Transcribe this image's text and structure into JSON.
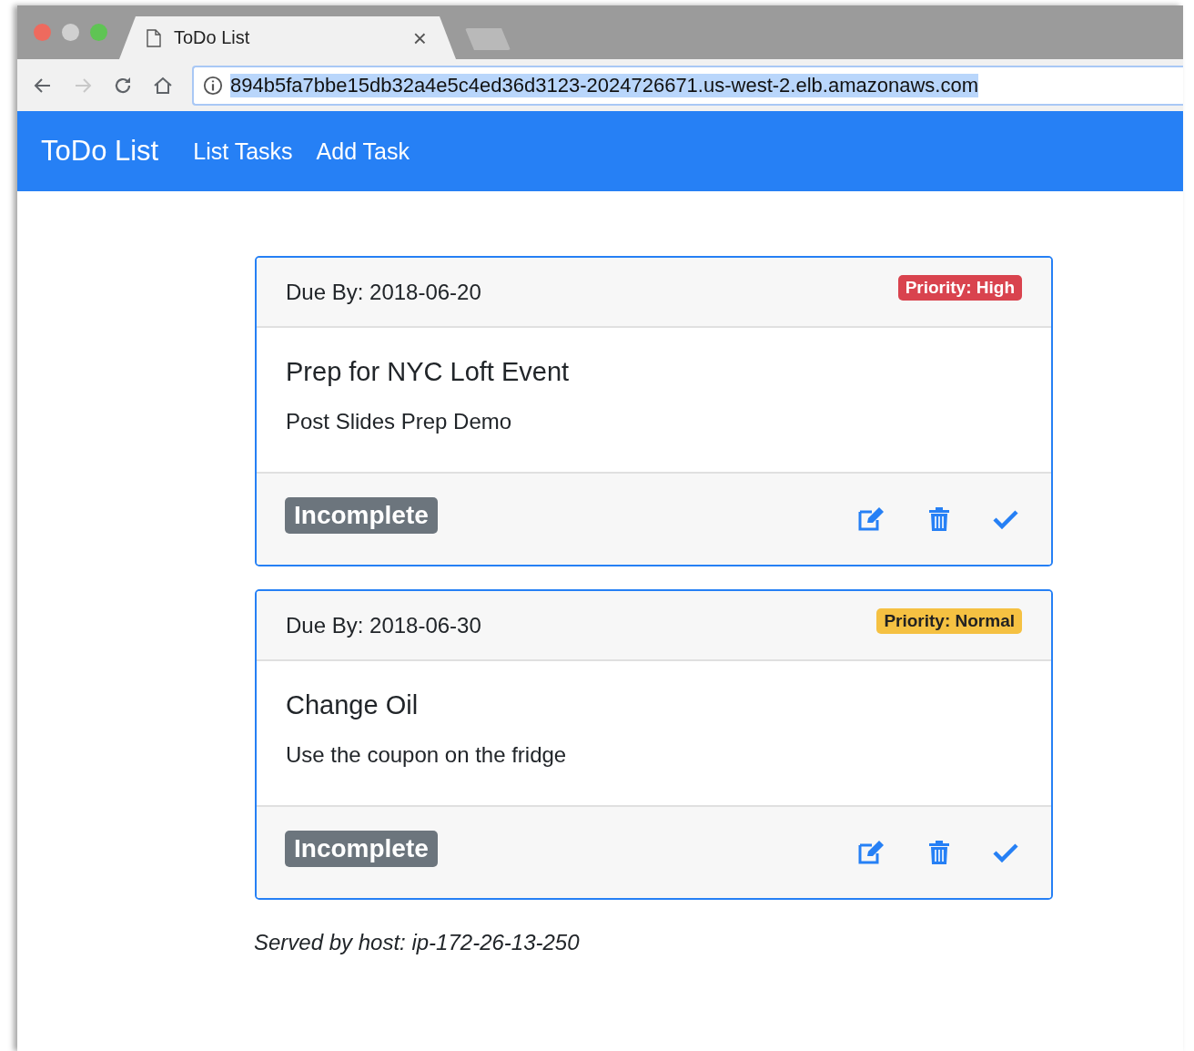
{
  "browser": {
    "tabs": [
      {
        "title": "ToDo List",
        "close": "×",
        "selected": true
      }
    ],
    "address_bar": {
      "url": "894b5fa7bbe15db32a4e5c4ed36d3123-2024726671.us-west-2.elb.amazonaws.com",
      "selected": true
    }
  },
  "navbar": {
    "brand": "ToDo List",
    "links": [
      "List Tasks",
      "Add Task"
    ]
  },
  "tasks": [
    {
      "due": "Due By: 2018-06-20",
      "priority": {
        "label": "Priority: High",
        "color": "#d9434e"
      },
      "title": "Prep for NYC Loft Event",
      "description": "Post Slides Prep Demo",
      "status": "Incomplete"
    },
    {
      "due": "Due By: 2018-06-30",
      "priority": {
        "label": "Priority: Normal",
        "color": "#f5c142"
      },
      "title": "Change Oil",
      "description": "Use the coupon on the fridge",
      "status": "Incomplete"
    }
  ],
  "footer": "Served by host: ip-172-26-13-250"
}
